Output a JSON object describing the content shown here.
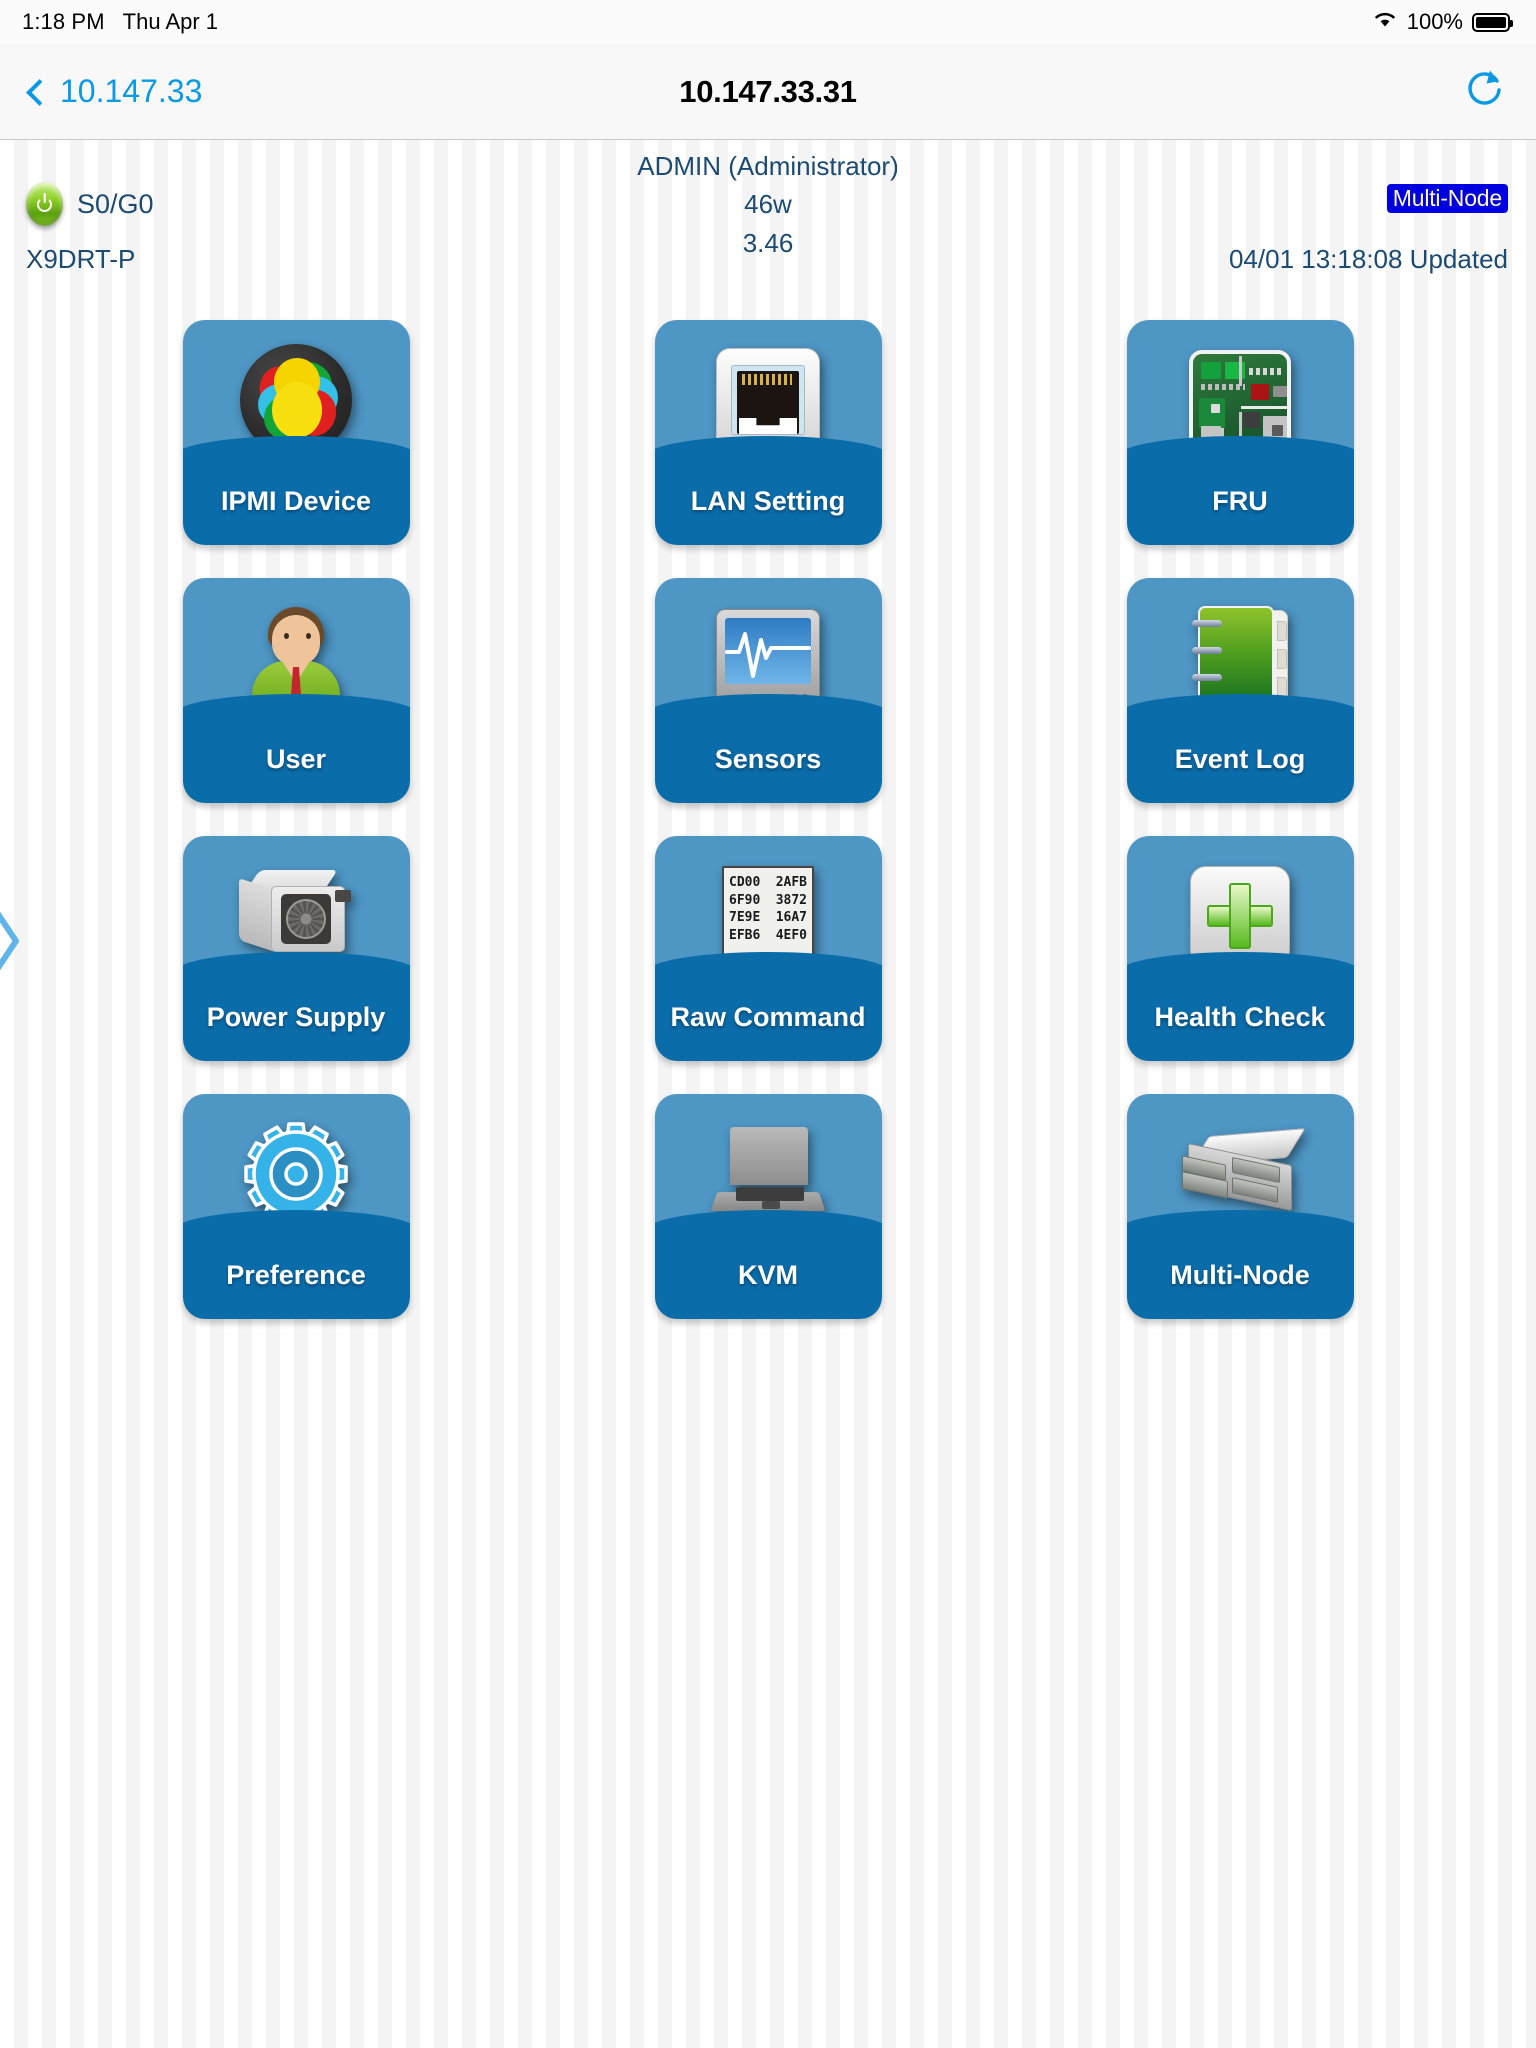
{
  "status_bar": {
    "time": "1:18 PM",
    "date": "Thu Apr 1",
    "battery_percent": "100%",
    "wifi_icon": "wifi-icon",
    "battery_icon": "battery-full-icon"
  },
  "nav_bar": {
    "back_label": "10.147.33",
    "title": "10.147.33.31",
    "refresh_icon": "refresh-icon",
    "back_icon": "chevron-left-icon"
  },
  "info": {
    "power_state": "S0/G0",
    "power_icon": "power-on-icon",
    "user": "ADMIN (Administrator)",
    "wattage": "46w",
    "firmware_version": "3.46",
    "badge": "Multi-Node",
    "model": "X9DRT-P",
    "updated": "04/01 13:18:08 Updated"
  },
  "colors": {
    "tile_top": "#4e96c4",
    "tile_band": "#0b6caa",
    "accent_blue": "#0a9ae5",
    "info_text": "#1b4a73",
    "badge_bg": "#0000e0",
    "badge_text": "#fdf8c8"
  },
  "tiles": [
    {
      "label": "IPMI Device",
      "icon": "ipmi-device-icon"
    },
    {
      "label": "LAN Setting",
      "icon": "ethernet-port-icon"
    },
    {
      "label": "FRU",
      "icon": "circuit-board-icon"
    },
    {
      "label": "User",
      "icon": "user-avatar-icon"
    },
    {
      "label": "Sensors",
      "icon": "monitor-waveform-icon"
    },
    {
      "label": "Event Log",
      "icon": "notebook-icon"
    },
    {
      "label": "Power Supply",
      "icon": "power-supply-unit-icon"
    },
    {
      "label": "Raw Command",
      "icon": "hex-document-icon"
    },
    {
      "label": "Health Check",
      "icon": "green-cross-icon"
    },
    {
      "label": "Preference",
      "icon": "gear-icon"
    },
    {
      "label": "KVM",
      "icon": "laptop-icon"
    },
    {
      "label": "Multi-Node",
      "icon": "server-chassis-icon"
    }
  ],
  "raw_command_lines": [
    [
      "CD00",
      "2AFB"
    ],
    [
      "6F90",
      "3872"
    ],
    [
      "7E9E",
      "16A7"
    ],
    [
      "EFB6",
      "4EF0"
    ]
  ],
  "raw_command_ellipsis": "..."
}
